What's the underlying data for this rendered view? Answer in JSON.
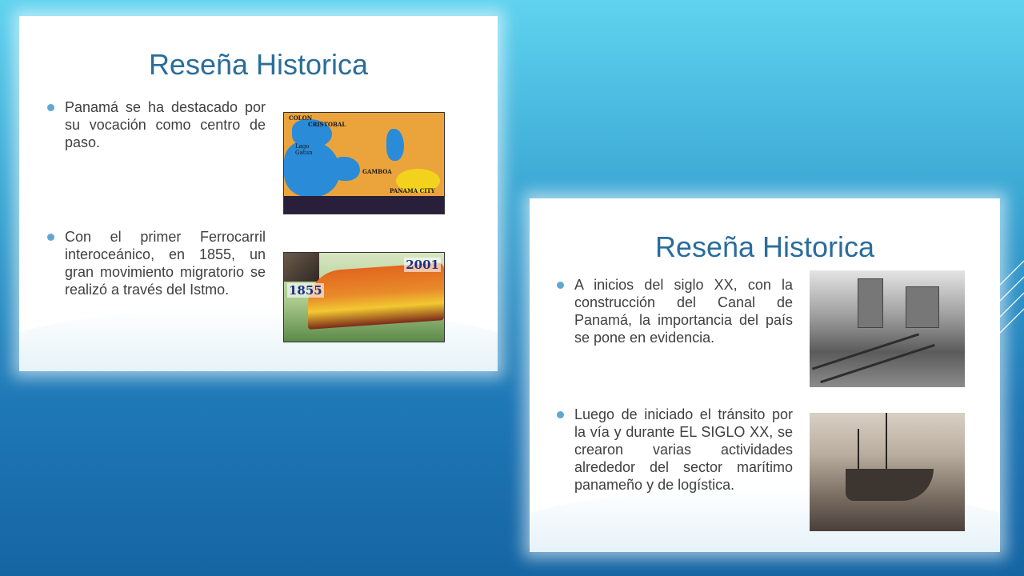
{
  "slide1": {
    "title": "Reseña Historica",
    "bullets": [
      "Panamá se ha destacado por su vocación como centro de paso.",
      "Con el primer Ferrocarril interoceánico, en 1855, un gran movimiento migratorio se realizó a través del Istmo."
    ],
    "map_labels": {
      "colon": "COLON",
      "cristobal": "CRISTOBAL",
      "lago": "Lago",
      "gatun": "Gatun",
      "gamboa": "GAMBOA",
      "panama_city": "PANAMA CITY"
    },
    "train_years": {
      "old": "1855",
      "new": "2001"
    }
  },
  "slide2": {
    "title": "Reseña Historica",
    "bullets": [
      "A inicios del siglo XX, con la construcción del Canal de Panamá, la importancia del país se pone en evidencia.",
      "Luego de iniciado el tránsito por la vía y durante EL SIGLO XX, se crearon varias actividades alrededor del sector marítimo panameño y de logística."
    ]
  },
  "colors": {
    "title": "#2a6d9b",
    "bullet_dot": "#5fa8cf",
    "body_text": "#404040"
  }
}
